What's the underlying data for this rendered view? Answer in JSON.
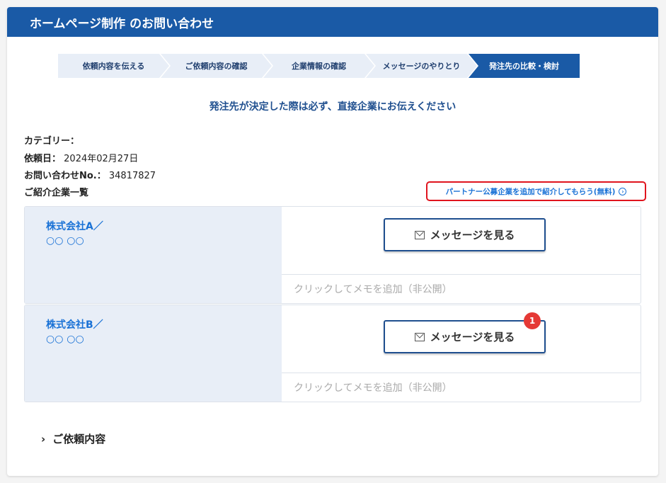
{
  "header": {
    "title": "ホームページ制作 のお問い合わせ"
  },
  "steps": [
    "依頼内容を伝える",
    "ご依頼内容の確認",
    "企業情報の確認",
    "メッセージのやりとり",
    "発注先の比較・検討"
  ],
  "active_step": 4,
  "notice": "発注先が決定した際は必ず、直接企業にお伝えください",
  "info": {
    "category_label": "カテゴリー：",
    "date_label": "依頼日：",
    "date": "2024年02月27日",
    "no_label": "お問い合わせNo.：",
    "no": "34817827",
    "list_label": "ご紹介企業一覧"
  },
  "partner_link": "パートナー公募企業を追加で紹介してもらう(無料)",
  "companies": [
    {
      "name": "株式会社A／",
      "person": "○○ ○○",
      "button": "メッセージを見る",
      "memo": "クリックしてメモを追加（非公開）"
    },
    {
      "name": "株式会社B／",
      "person": "○○ ○○",
      "button": "メッセージを見る",
      "memo": "クリックしてメモを追加（非公開）",
      "badge": "1"
    }
  ],
  "accordion": "ご依頼内容",
  "colors": {
    "brand": "#1a5aa6",
    "link": "#1a72d6",
    "badge": "#e53935"
  }
}
